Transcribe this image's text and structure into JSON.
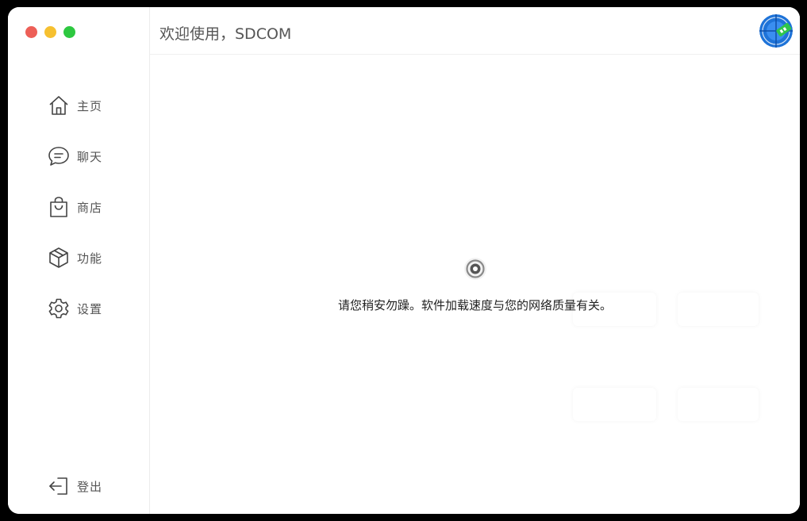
{
  "header": {
    "title": "欢迎使用，SDCOM"
  },
  "sidebar": {
    "items": [
      {
        "label": "主页",
        "icon": "home-icon"
      },
      {
        "label": "聊天",
        "icon": "chat-bubble-icon"
      },
      {
        "label": "商店",
        "icon": "shopping-bag-icon"
      },
      {
        "label": "功能",
        "icon": "cube-icon"
      },
      {
        "label": "设置",
        "icon": "gear-icon"
      }
    ],
    "logout": {
      "label": "登出",
      "icon": "logout-icon"
    }
  },
  "content": {
    "loading_text": "请您稍安勿躁。软件加载速度与您的网络质量有关。"
  },
  "colors": {
    "traffic_red": "#ed5f57",
    "traffic_yellow": "#f6c030",
    "traffic_green": "#2dc840",
    "avatar_blue": "#1e73d8",
    "avatar_green": "#2fc64a"
  }
}
